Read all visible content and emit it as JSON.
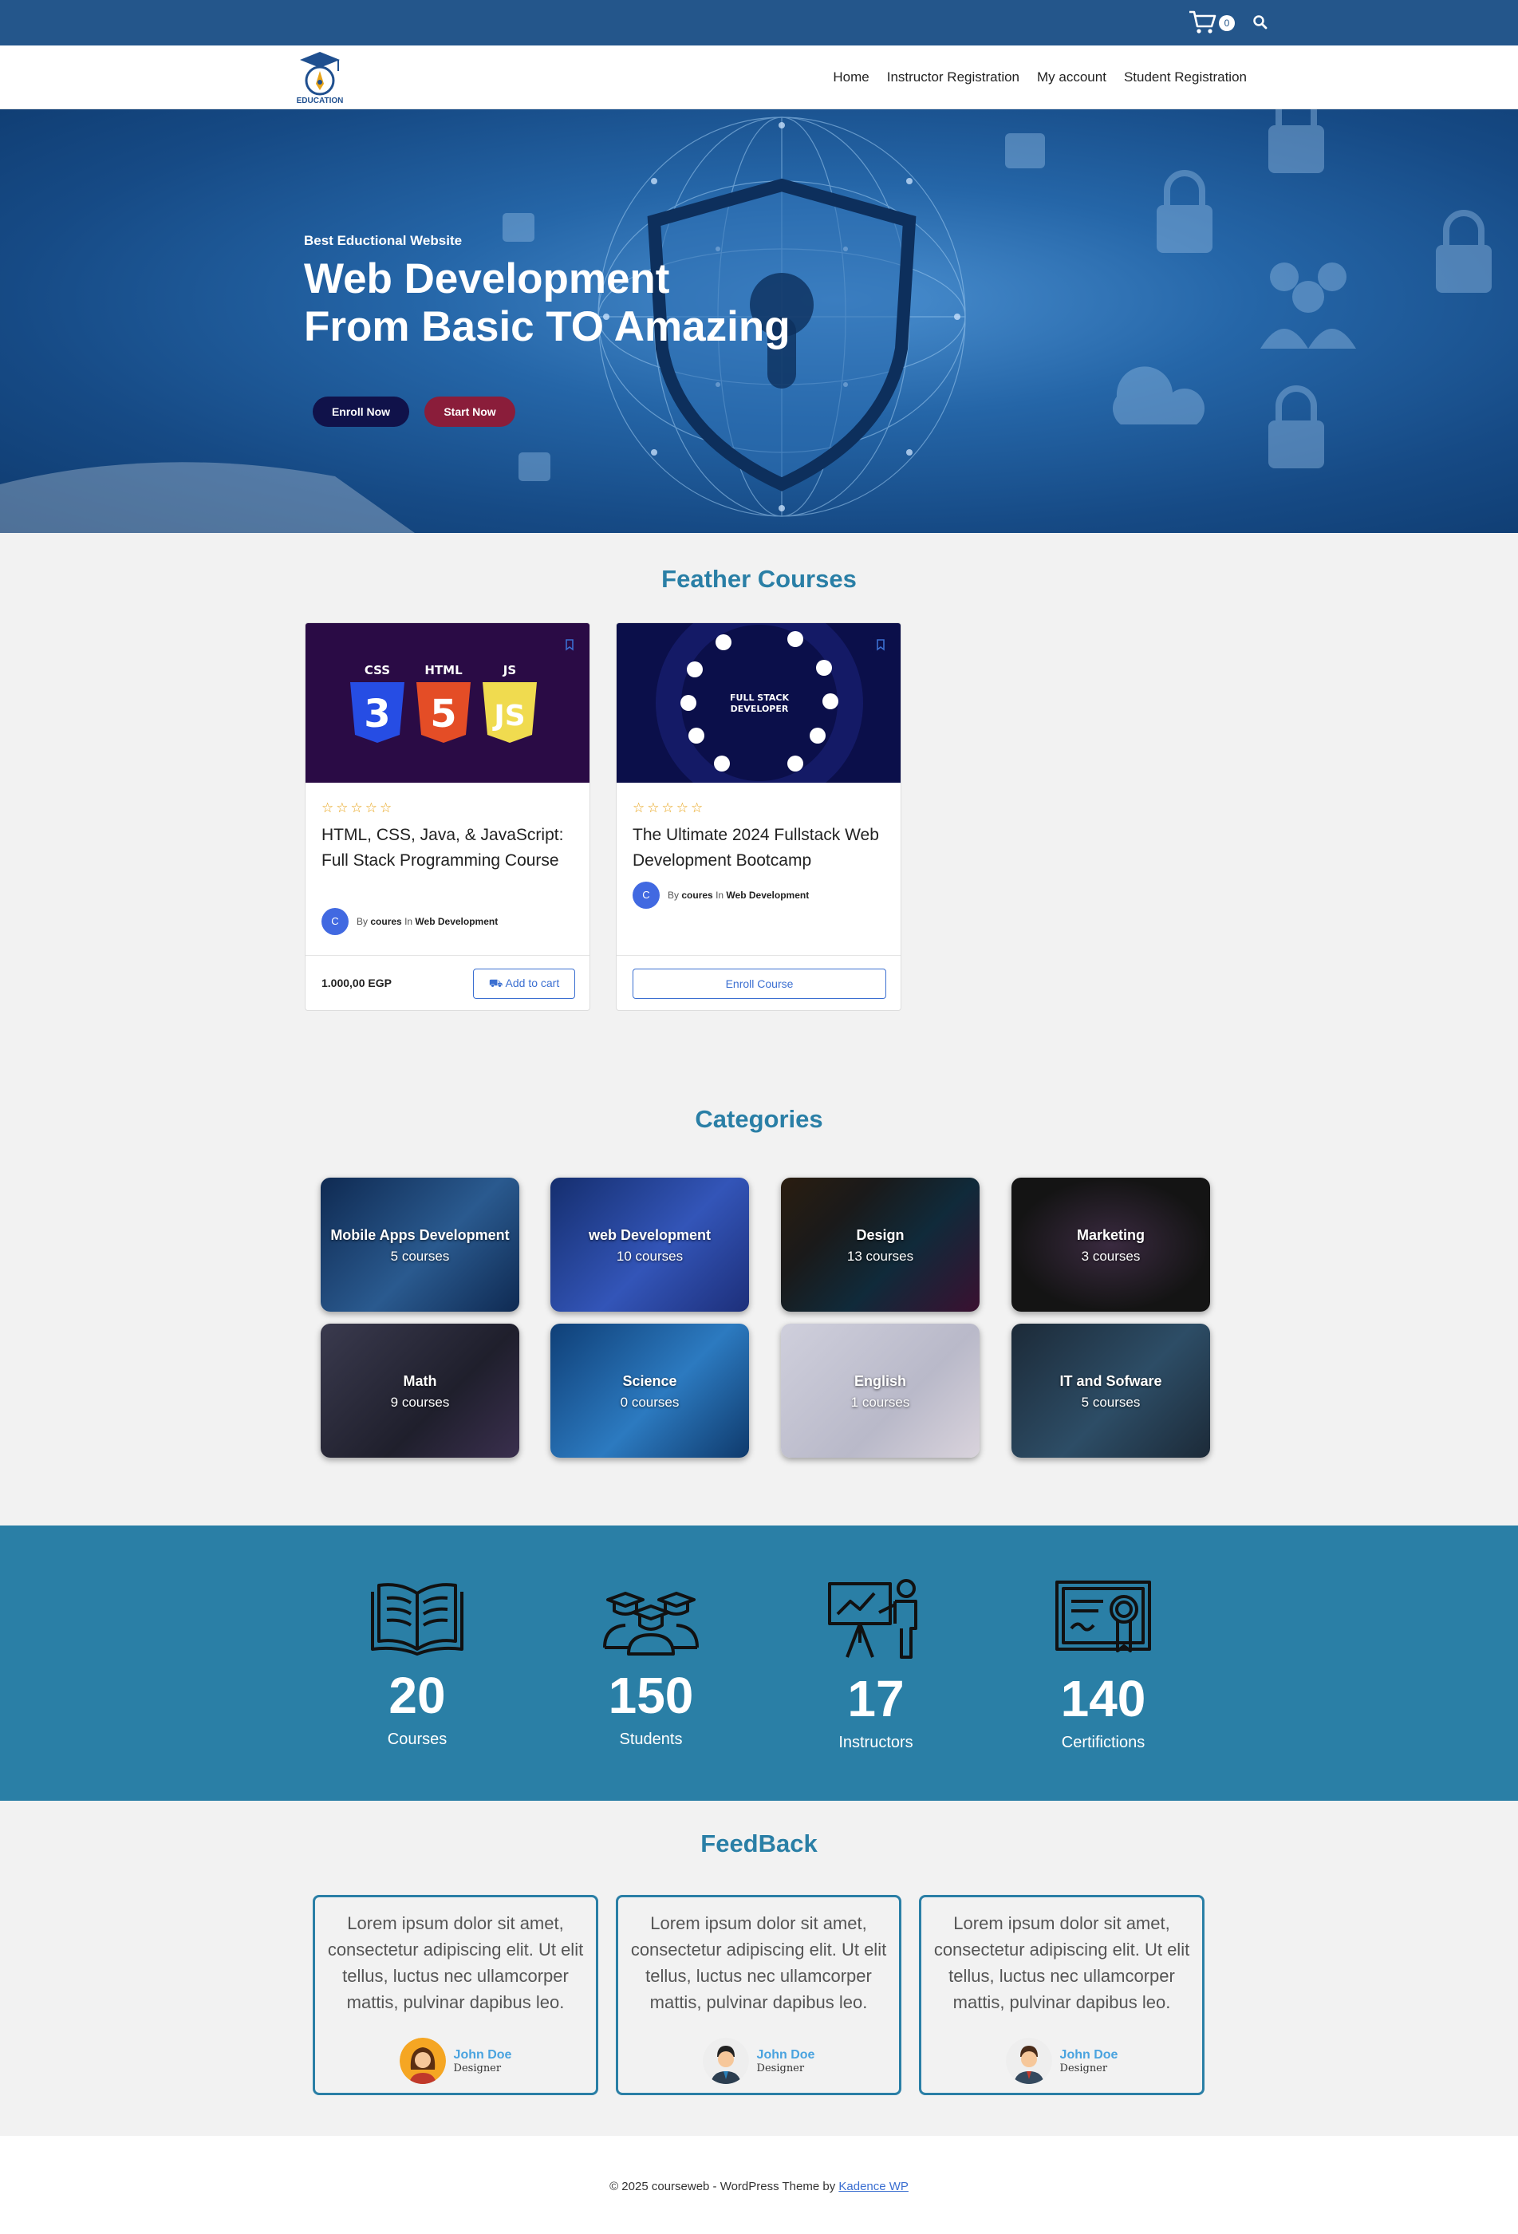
{
  "topbar": {
    "cart_count": "0",
    "cart_icon": "cart-icon",
    "search_icon": "search-icon"
  },
  "header": {
    "logo_text": "EDUCATION",
    "nav": [
      "Home",
      "Instructor Registration",
      "My account",
      "Student Registration"
    ]
  },
  "hero": {
    "subtitle": "Best Eductional Website",
    "title_line1": "Web Development",
    "title_line2": "From Basic TO Amazing",
    "enroll_label": "Enroll Now",
    "start_label": "Start Now"
  },
  "courses": {
    "title": "Feather Courses",
    "items": [
      {
        "title": "HTML, CSS, Java, & JavaScript: Full Stack Programming Course",
        "stars": "☆☆☆☆☆",
        "avatar": "C",
        "by": "By",
        "author": "coures",
        "in": "In",
        "category": "Web Development",
        "price": "1.000,00 EGP",
        "action": "Add to cart",
        "image_labels": [
          "CSS",
          "HTML",
          "JS"
        ]
      },
      {
        "title": "The Ultimate 2024 Fullstack Web Development Bootcamp",
        "stars": "☆☆☆☆☆",
        "avatar": "C",
        "by": "By",
        "author": "coures",
        "in": "In",
        "category": "Web Development",
        "action": "Enroll Course",
        "image_labels": [
          "FULL STACK",
          "DEVELOPER"
        ]
      }
    ]
  },
  "categories": {
    "title": "Categories",
    "items": [
      {
        "name": "Mobile Apps Development",
        "count": "5 courses",
        "color": "#1d3a6a"
      },
      {
        "name": "web Development",
        "count": "10 courses",
        "color": "#2b4aa0"
      },
      {
        "name": "Design",
        "count": "13 courses",
        "color": "#1a1a1a"
      },
      {
        "name": "Marketing",
        "count": "3 courses",
        "color": "#141414"
      },
      {
        "name": "Math",
        "count": "9 courses",
        "color": "#2c2c3a"
      },
      {
        "name": "Science",
        "count": "0 courses",
        "color": "#1e5c94"
      },
      {
        "name": "English",
        "count": "1 courses",
        "color": "#c9c9d6"
      },
      {
        "name": "IT and Sofware",
        "count": "5 courses",
        "color": "#1c2a38"
      }
    ]
  },
  "stats": [
    {
      "num": "20",
      "label": "Courses",
      "icon": "book-icon"
    },
    {
      "num": "150",
      "label": "Students",
      "icon": "students-icon"
    },
    {
      "num": "17",
      "label": "Instructors",
      "icon": "instructor-icon"
    },
    {
      "num": "140",
      "label": "Certifictions",
      "icon": "certificate-icon"
    }
  ],
  "feedback": {
    "title": "FeedBack",
    "items": [
      {
        "text": "Lorem ipsum dolor sit amet, consectetur adipiscing elit. Ut elit tellus, luctus nec ullamcorper mattis, pulvinar dapibus leo.",
        "name": "John Doe",
        "role": "Designer"
      },
      {
        "text": "Lorem ipsum dolor sit amet, consectetur adipiscing elit. Ut elit tellus, luctus nec ullamcorper mattis, pulvinar dapibus leo.",
        "name": "John Doe",
        "role": "Designer"
      },
      {
        "text": "Lorem ipsum dolor sit amet, consectetur adipiscing elit. Ut elit tellus, luctus nec ullamcorper mattis, pulvinar dapibus leo.",
        "name": "John Doe",
        "role": "Designer"
      }
    ]
  },
  "footer": {
    "text": "© 2025 courseweb - WordPress Theme by ",
    "link": "Kadence WP"
  },
  "colors": {
    "topbar": "#24568b",
    "accent": "#2a7fa6",
    "enroll_btn": "#10124a",
    "start_btn": "#8a1d3a",
    "link": "#3b6fd1"
  }
}
